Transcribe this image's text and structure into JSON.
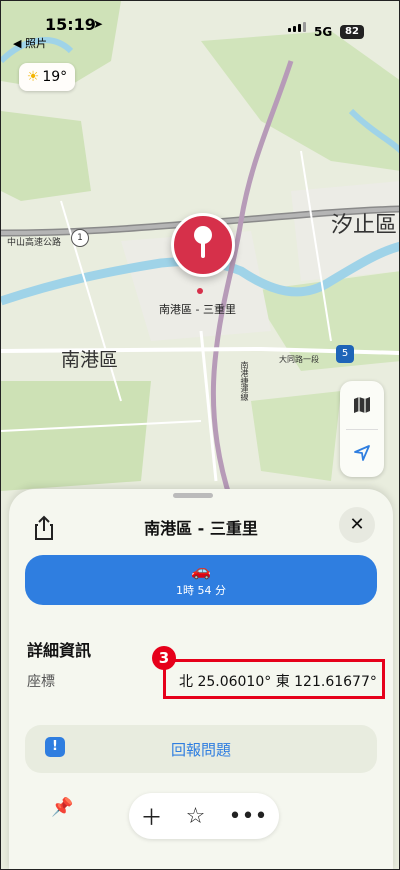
{
  "status_bar": {
    "time": "15:19",
    "location_arrow": "➤",
    "back_app": "◀ 照片",
    "network": "5G",
    "battery": "82"
  },
  "weather": {
    "icon": "sun-icon",
    "temperature": "19°"
  },
  "map": {
    "labels": {
      "xizhi": "汐止區",
      "nangang": "南港區",
      "highway": "中山高速公路",
      "route1": "1",
      "route5": "5",
      "datong": "大同路一段",
      "nangang_rail": "南港捷運線",
      "pin_label": "南港區 - 三重里"
    },
    "pin_color": "#d6304a"
  },
  "map_controls": {
    "map_icon": "map-icon",
    "locate_icon": "location-arrow-icon"
  },
  "sheet": {
    "title": "南港區 - 三重里",
    "route": {
      "icon": "car-icon",
      "duration": "1時 54 分"
    },
    "details_title": "詳細資訊",
    "coords_label": "座標",
    "coords_value": "北 25.06010° 東 121.61677°",
    "annotation_number": "3",
    "report_label": "回報問題",
    "accent_color": "#2f7ee0",
    "annotation_color": "#e6001a"
  }
}
